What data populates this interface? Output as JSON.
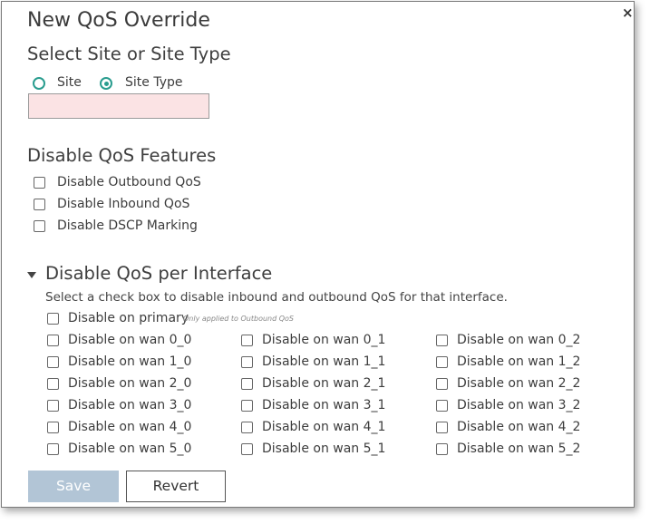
{
  "dialog": {
    "title": "New QoS Override",
    "close_glyph": "×"
  },
  "site_section": {
    "heading": "Select Site or Site Type",
    "options": [
      {
        "label": "Site",
        "selected": false
      },
      {
        "label": "Site Type",
        "selected": true
      }
    ],
    "input_value": ""
  },
  "features": {
    "heading": "Disable QoS Features",
    "items": [
      "Disable Outbound QoS",
      "Disable Inbound QoS",
      "Disable DSCP Marking"
    ]
  },
  "interfaces": {
    "heading": "Disable QoS per Interface",
    "description": "Select a check box to disable inbound and outbound QoS for that interface.",
    "primary_label": "Disable on primary",
    "primary_hint": "Only applied to Outbound QoS",
    "columns": [
      [
        "Disable on wan 0_0",
        "Disable on wan 1_0",
        "Disable on wan 2_0",
        "Disable on wan 3_0",
        "Disable on wan 4_0",
        "Disable on wan 5_0"
      ],
      [
        "Disable on wan 0_1",
        "Disable on wan 1_1",
        "Disable on wan 2_1",
        "Disable on wan 3_1",
        "Disable on wan 4_1",
        "Disable on wan 5_1"
      ],
      [
        "Disable on wan 0_2",
        "Disable on wan 1_2",
        "Disable on wan 2_2",
        "Disable on wan 3_2",
        "Disable on wan 4_2",
        "Disable on wan 5_2"
      ]
    ]
  },
  "buttons": {
    "save_label": "Save",
    "revert_label": "Revert"
  },
  "colors": {
    "accent": "#2a9d8f",
    "input_error_bg": "#fbe3e4",
    "save_disabled": "#b2c5d6"
  }
}
